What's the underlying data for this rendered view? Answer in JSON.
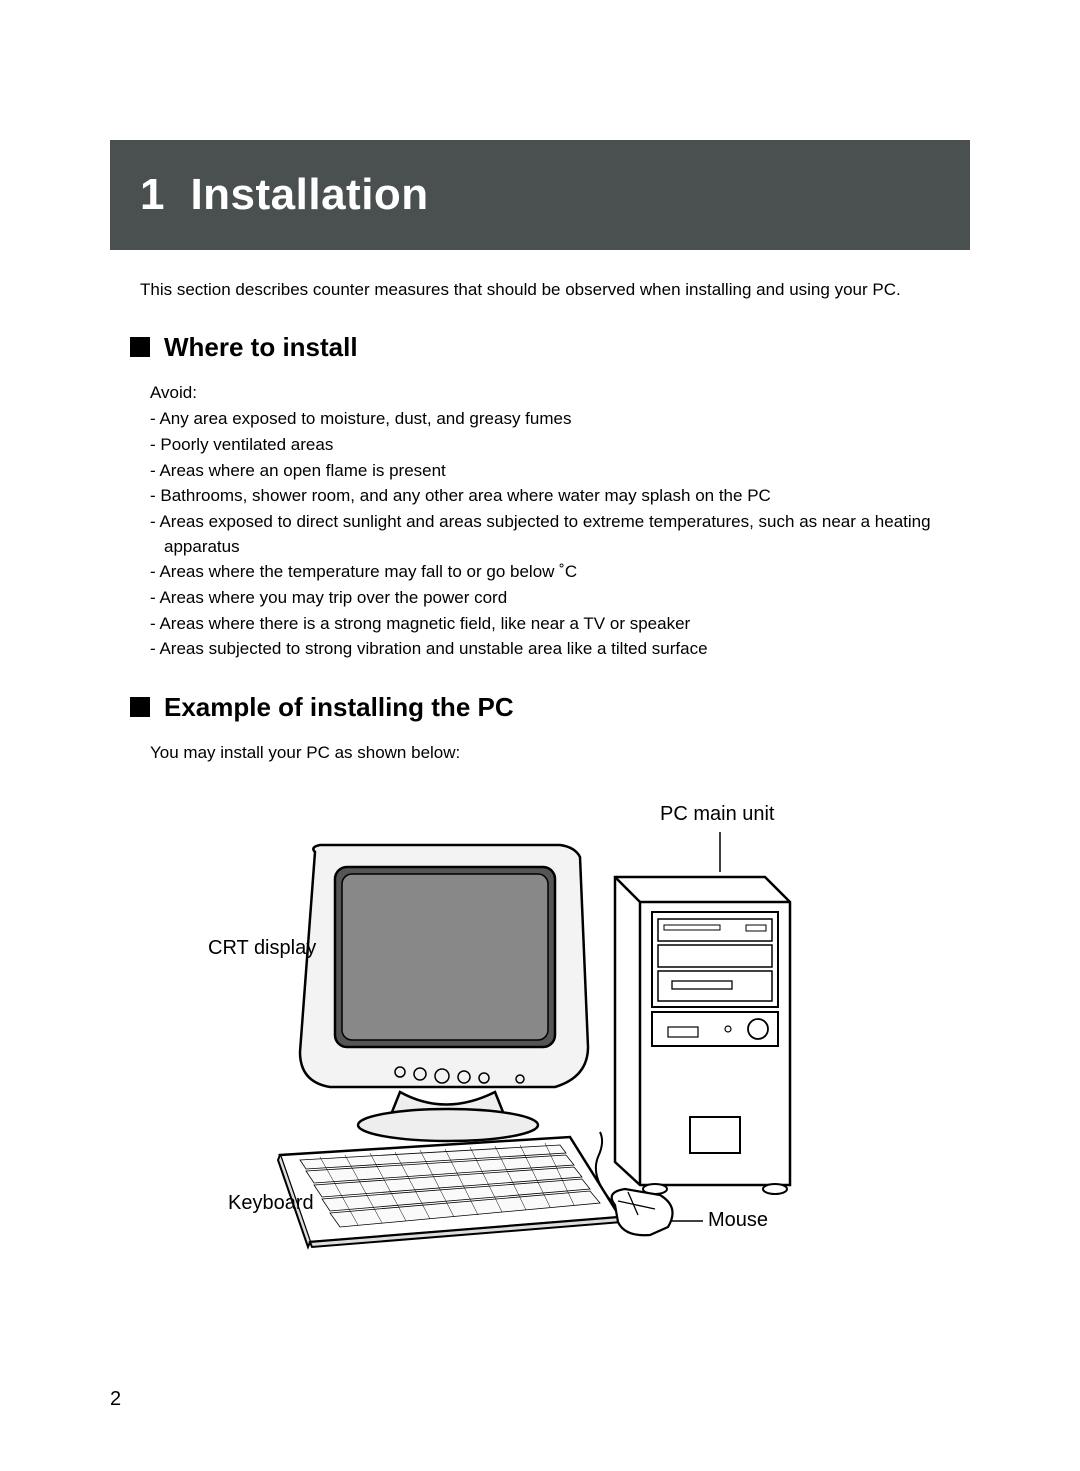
{
  "banner": {
    "number": "1",
    "title": "Installation"
  },
  "intro": "This section describes counter measures that should be observed when installing and using your PC.",
  "headings": {
    "where": "Where to install",
    "example": "Example of installing the PC"
  },
  "avoid": {
    "lead": "Avoid:",
    "items": [
      "Any area exposed to moisture, dust, and greasy fumes",
      "Poorly ventilated areas",
      "Areas where an open flame is present",
      "Bathrooms, shower room, and any other area where water may splash on the PC",
      "Areas exposed to direct sunlight and areas subjected to extreme temperatures, such as  near a heating apparatus",
      "Areas where the temperature may fall to or go below ˚C",
      "Areas where you may trip over the power cord",
      "Areas where there is a strong magnetic field, like near a TV or speaker",
      "Areas subjected to strong vibration and unstable area like a tilted surface"
    ]
  },
  "example_lead": "You may install your PC as shown below:",
  "diagram": {
    "pc_main_unit": "PC main unit",
    "crt_display": "CRT display",
    "keyboard": "Keyboard",
    "mouse": "Mouse"
  },
  "page_number": "2"
}
